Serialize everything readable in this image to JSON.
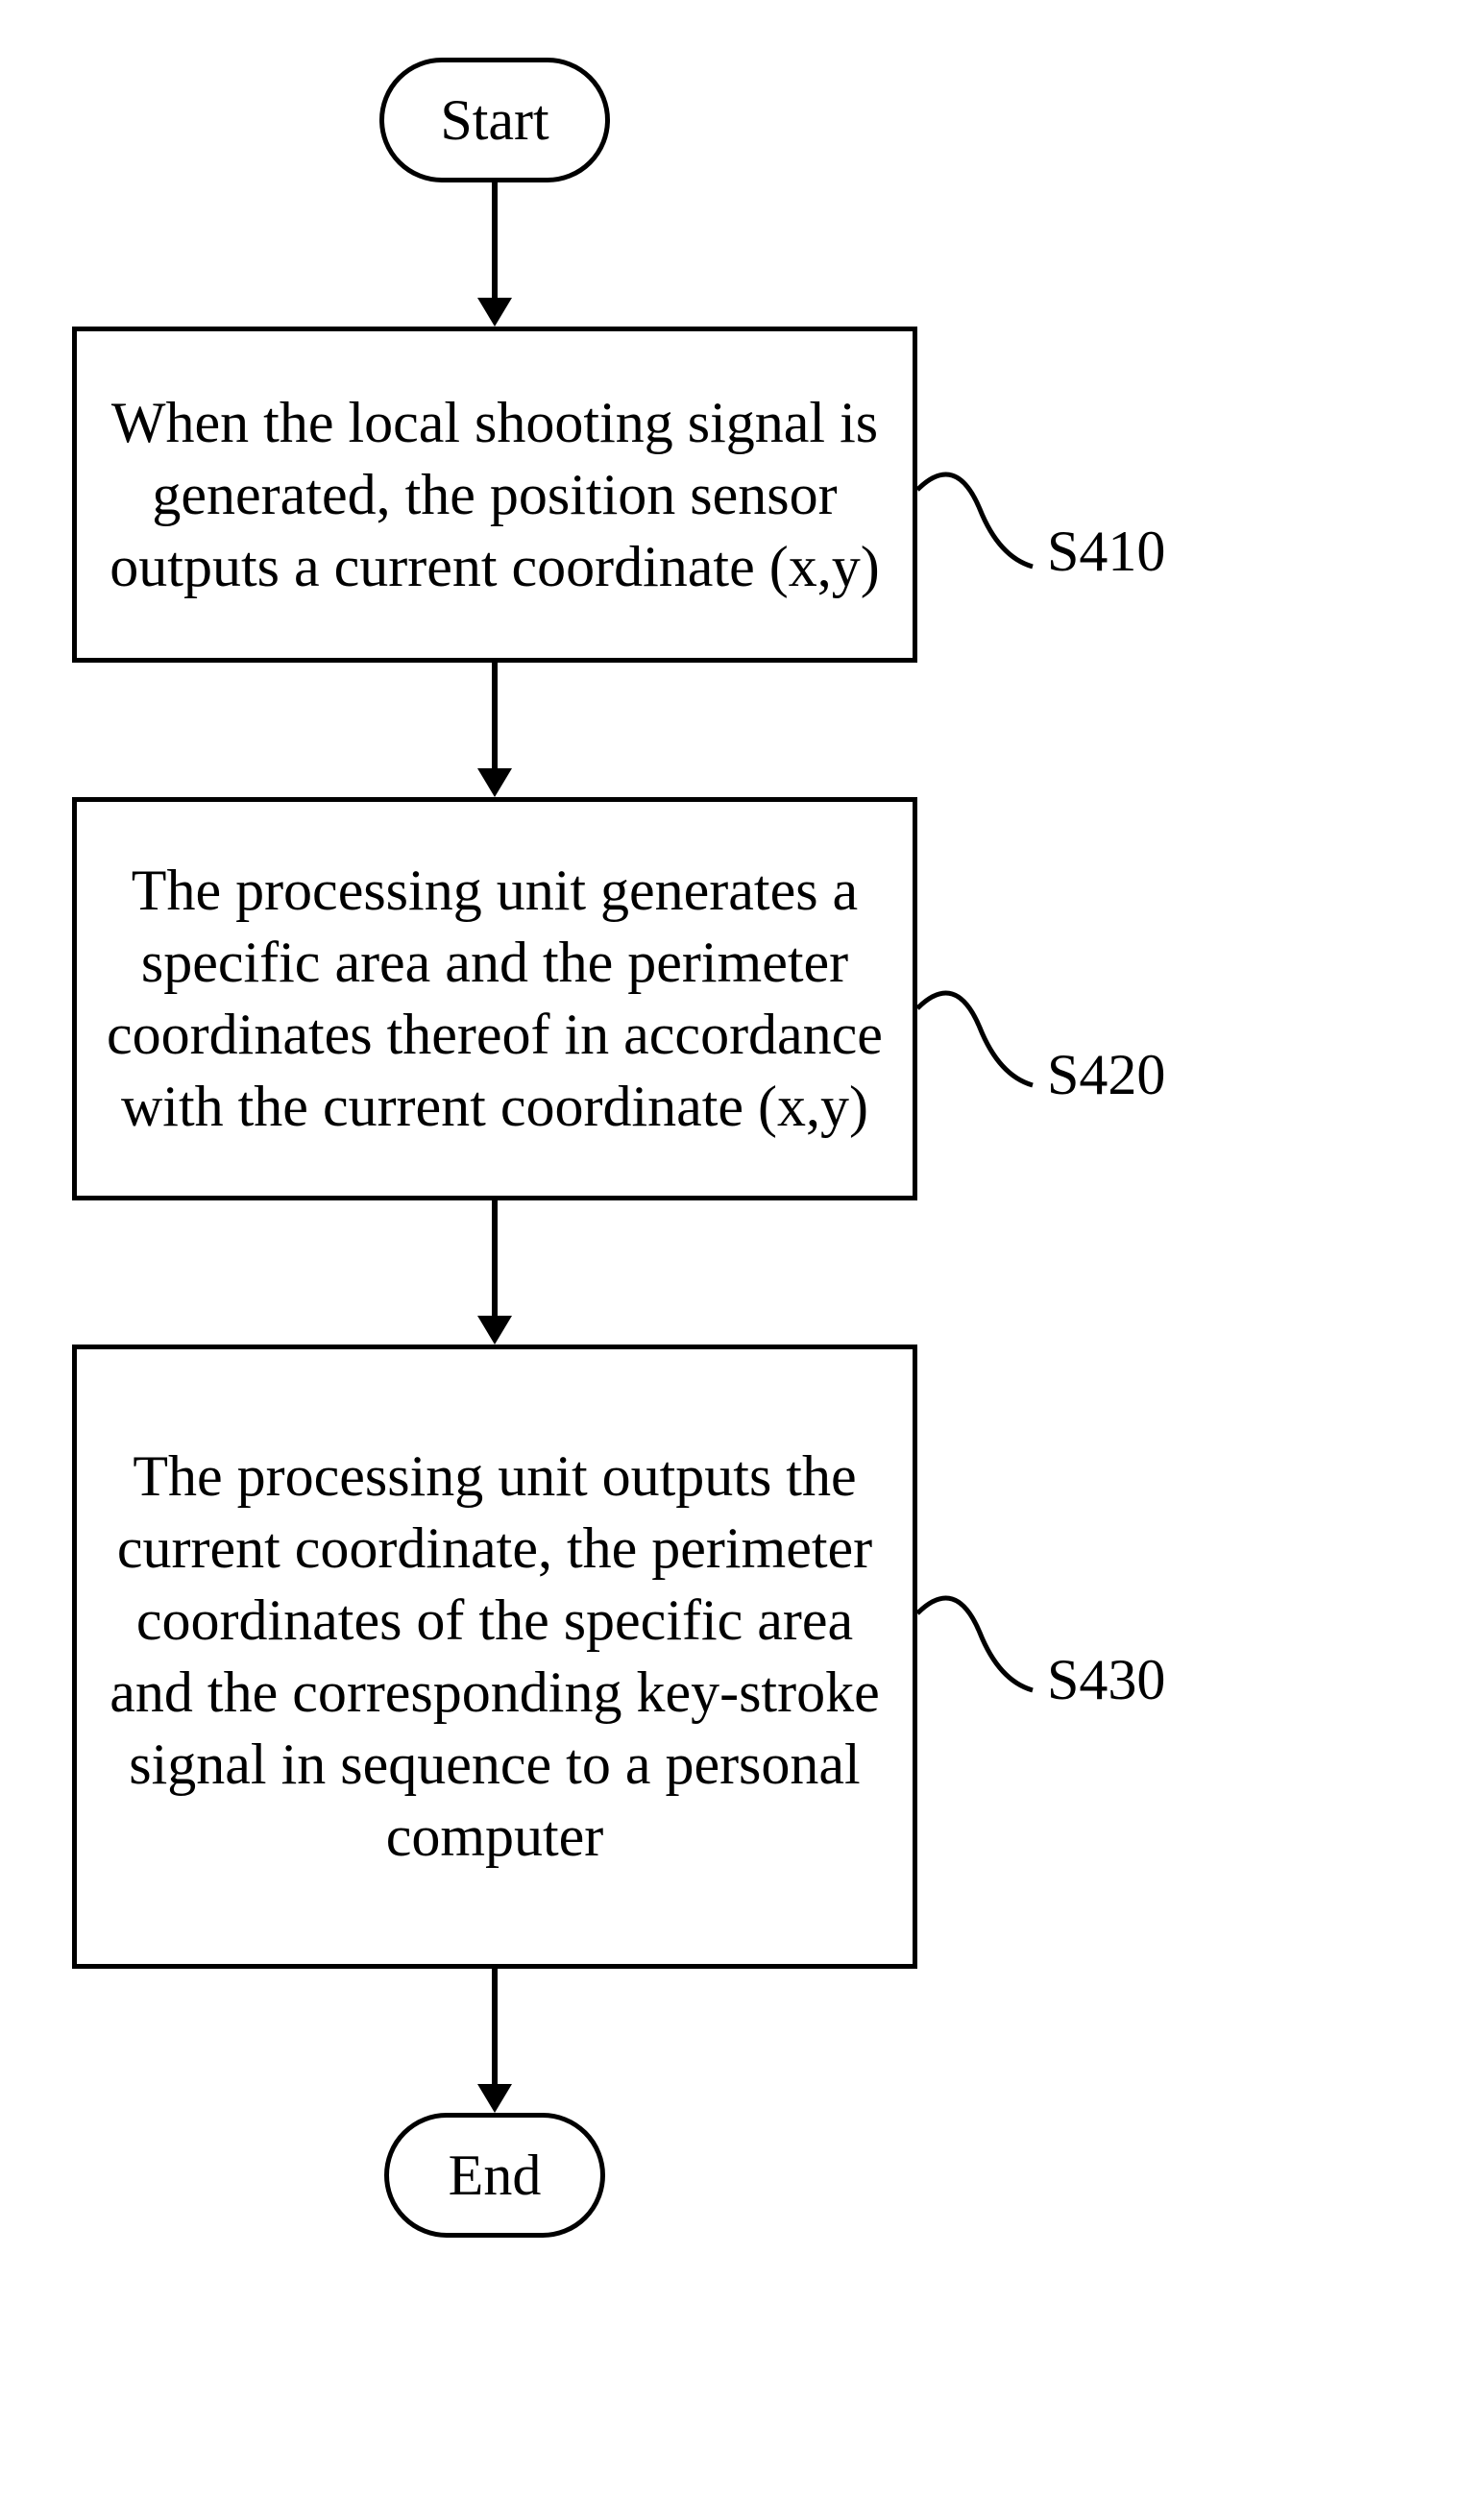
{
  "terminators": {
    "start": "Start",
    "end": "End"
  },
  "steps": {
    "s410": {
      "label": "S410",
      "text": "When the local shooting signal is generated, the position sensor  outputs a current coordinate (x,y)"
    },
    "s420": {
      "label": "S420",
      "text": "The processing unit generates a specific area and the perimeter coordinates thereof in accordance with the current coordinate (x,y)"
    },
    "s430": {
      "label": "S430",
      "text": "The processing unit outputs the current coordinate, the perimeter coordinates of the specific area and the corresponding key-stroke signal in sequence to a personal computer"
    }
  }
}
